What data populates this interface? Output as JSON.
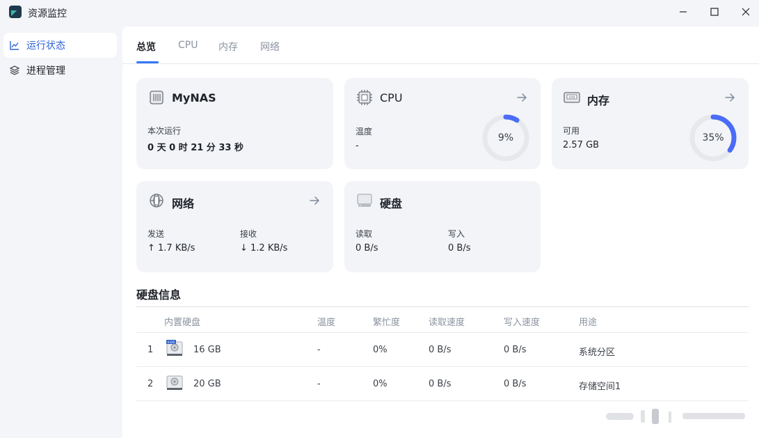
{
  "window": {
    "title": "资源监控"
  },
  "sidebar": {
    "items": [
      {
        "label": "运行状态",
        "icon": "chart-line-icon",
        "active": true
      },
      {
        "label": "进程管理",
        "icon": "layers-icon",
        "active": false
      }
    ]
  },
  "tabs": [
    "总览",
    "CPU",
    "内存",
    "网络"
  ],
  "cards": {
    "system": {
      "title": "MyNAS",
      "uptime_label": "本次运行",
      "uptime_value": "0 天 0 时 21 分 33 秒"
    },
    "cpu": {
      "title": "CPU",
      "temp_label": "温度",
      "temp_value": "-",
      "usage_text": "9%",
      "usage_fraction": 0.09
    },
    "memory": {
      "title": "内存",
      "avail_label": "可用",
      "avail_value": "2.57 GB",
      "usage_text": "35%",
      "usage_fraction": 0.35
    },
    "network": {
      "title": "网络",
      "send_label": "发送",
      "send_value": "↑ 1.7 KB/s",
      "recv_label": "接收",
      "recv_value": "↓ 1.2 KB/s"
    },
    "disk": {
      "title": "硬盘",
      "read_label": "读取",
      "read_value": "0 B/s",
      "write_label": "写入",
      "write_value": "0 B/s"
    }
  },
  "disk_info": {
    "title": "硬盘信息",
    "columns": [
      "内置硬盘",
      "温度",
      "繁忙度",
      "读取速度",
      "写入速度",
      "用途"
    ],
    "rows": [
      {
        "index": "1",
        "size": "16 GB",
        "temp": "-",
        "busy": "0%",
        "read": "0 B/s",
        "write": "0 B/s",
        "usage": "系统分区",
        "badge": "fnOS"
      },
      {
        "index": "2",
        "size": "20 GB",
        "temp": "-",
        "busy": "0%",
        "read": "0 B/s",
        "write": "0 B/s",
        "usage": "存储空间1"
      }
    ]
  },
  "colors": {
    "accent": "#3478f6",
    "ring": "#4a6cf7",
    "ring_track": "#e6e8ec"
  }
}
